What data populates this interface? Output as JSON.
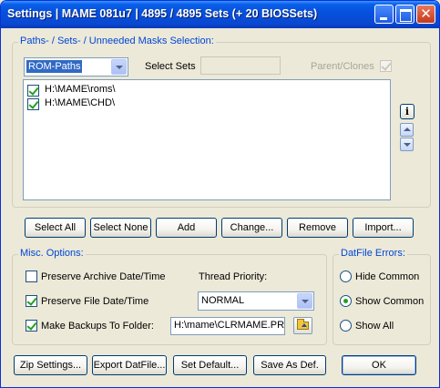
{
  "window": {
    "title": "Settings  |  MAME 081u7  |  4895 / 4895 Sets  (+ 20 BIOSSets)"
  },
  "paths_group": {
    "legend": "Paths- / Sets- / Unneeded Masks Selection:",
    "mode_select": {
      "selected": "ROM-Paths"
    },
    "select_sets_label": "Select Sets",
    "select_sets_value": "",
    "parent_clones_label": "Parent/Clones",
    "parent_clones_checked": true,
    "paths": [
      {
        "path": "H:\\MAME\\roms\\",
        "checked": true
      },
      {
        "path": "H:\\MAME\\CHD\\",
        "checked": true
      }
    ],
    "info_icon": "i"
  },
  "path_buttons": {
    "select_all": "Select All",
    "select_none": "Select None",
    "add": "Add",
    "change": "Change...",
    "remove": "Remove",
    "import": "Import..."
  },
  "misc_group": {
    "legend": "Misc. Options:",
    "preserve_archive_label": "Preserve Archive Date/Time",
    "preserve_archive_checked": false,
    "preserve_file_label": "Preserve File Date/Time",
    "preserve_file_checked": true,
    "make_backups_label": "Make Backups To Folder:",
    "make_backups_checked": true,
    "thread_priority_label": "Thread Priority:",
    "thread_priority_value": "NORMAL",
    "backup_folder": "H:\\mame\\CLRMAME.PR"
  },
  "datfile_group": {
    "legend": "DatFile Errors:",
    "options": [
      {
        "label": "Hide Common",
        "selected": false
      },
      {
        "label": "Show Common",
        "selected": true
      },
      {
        "label": "Show All",
        "selected": false
      }
    ]
  },
  "bottom_buttons": {
    "zip_settings": "Zip Settings...",
    "export_datfile": "Export DatFile...",
    "set_default": "Set Default...",
    "save_as_def": "Save As Def.",
    "ok": "OK"
  }
}
